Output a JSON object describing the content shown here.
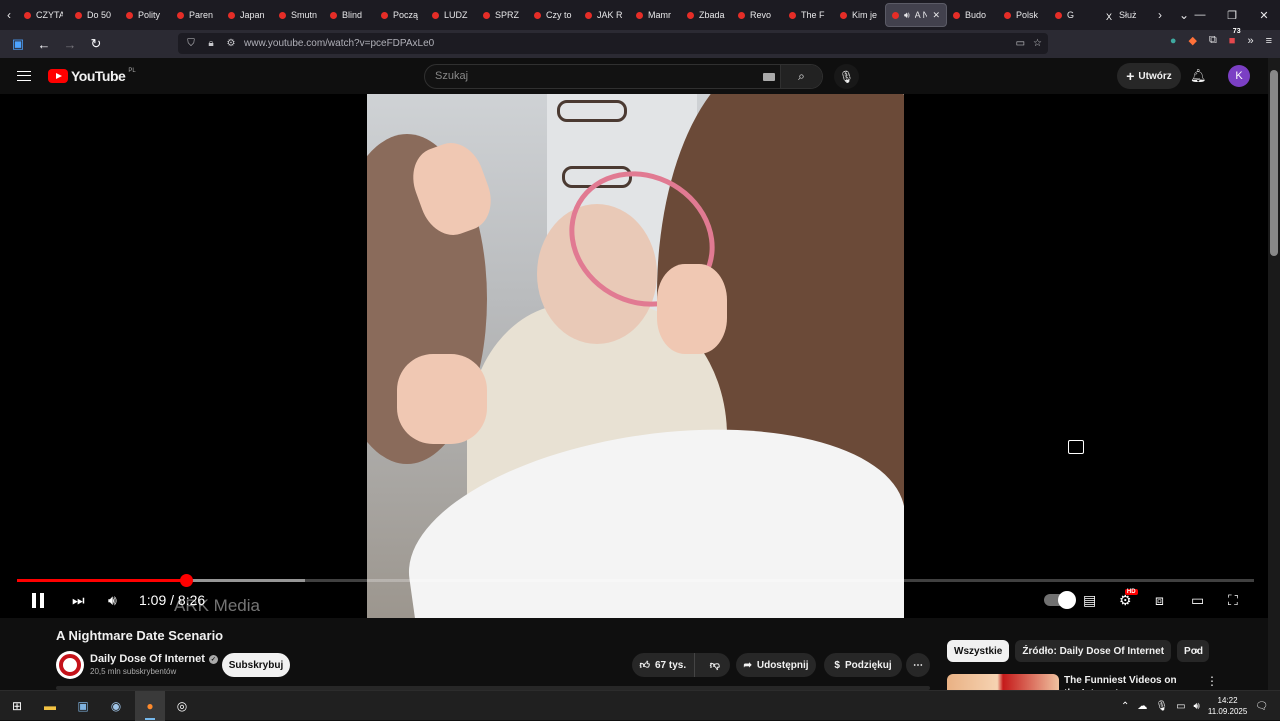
{
  "browser": {
    "tabs": [
      {
        "label": "CZYTA"
      },
      {
        "label": "Do 50"
      },
      {
        "label": "Polity"
      },
      {
        "label": "Paren"
      },
      {
        "label": "Japan"
      },
      {
        "label": "Smutn"
      },
      {
        "label": "Blind"
      },
      {
        "label": "Począ"
      },
      {
        "label": "LUDZ"
      },
      {
        "label": "SPRZ"
      },
      {
        "label": "Czy to"
      },
      {
        "label": "JAK R"
      },
      {
        "label": "Mamr"
      },
      {
        "label": "Zbada"
      },
      {
        "label": "Revo"
      },
      {
        "label": "The F"
      },
      {
        "label": "Kim je"
      },
      {
        "label": "A N"
      },
      {
        "label": "Budo"
      },
      {
        "label": "Polsk"
      },
      {
        "label": "G"
      },
      {
        "label": "Służ"
      }
    ],
    "active_tab_index": 17,
    "url": "www.youtube.com/watch?v=pceFDPAxLe0",
    "extension_badge": "73"
  },
  "youtube": {
    "logo_text": "YouTube",
    "logo_country": "PL",
    "search_placeholder": "Szukaj",
    "create_label": "Utwórz",
    "avatar_letter": "K"
  },
  "player": {
    "current_time": "1:09",
    "duration": "8:26",
    "time_separator": " / ",
    "played_fraction": 0.1364,
    "buffered_fraction": 0.233,
    "watermark": "ARK Media",
    "hd_badge": "HD"
  },
  "video": {
    "title": "A Nightmare Date Scenario",
    "channel": "Daily Dose Of Internet",
    "subscribers": "20,5 mln subskrybentów",
    "subscribe_label": "Subskrybuj",
    "likes": "67 tys.",
    "share_label": "Udostępnij",
    "thanks_label": "Podziękuj"
  },
  "sidebar": {
    "chips": [
      "Wszystkie",
      "Źródło: Daily Dose Of Internet",
      "Pod"
    ],
    "rec_title": "The Funniest Videos on the Internet"
  },
  "taskbar": {
    "time": "14:22",
    "date": "11.09.2025"
  },
  "colors": {
    "accent": "#ff0000",
    "bg": "#0f0f0f",
    "browser_chrome": "#1c1b22"
  }
}
